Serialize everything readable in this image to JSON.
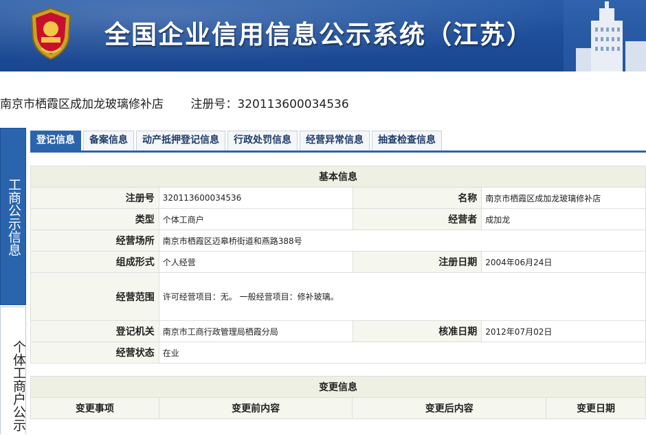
{
  "banner": {
    "title": "全国企业信用信息公示系统（江苏）",
    "emblem_icon": "national-emblem-icon",
    "colors": {
      "background": "#1f4f9a",
      "title": "#ffffff"
    }
  },
  "company": {
    "name": "南京市栖霞区成加龙玻璃修补店",
    "reg_label": "注册号：320113600034536"
  },
  "side_tabs": [
    {
      "label": "工商公示信息",
      "active": true
    },
    {
      "label": "个体工商户公示",
      "active": false
    }
  ],
  "tabs": [
    {
      "label": "登记信息",
      "active": true
    },
    {
      "label": "备案信息",
      "active": false
    },
    {
      "label": "动产抵押登记信息",
      "active": false
    },
    {
      "label": "行政处罚信息",
      "active": false
    },
    {
      "label": "经营异常信息",
      "active": false
    },
    {
      "label": "抽查检查信息",
      "active": false
    }
  ],
  "basic_info": {
    "title": "基本信息",
    "reg_no_label": "注册号",
    "reg_no": "320113600034536",
    "name_label": "名称",
    "name": "南京市栖霞区成加龙玻璃修补店",
    "type_label": "类型",
    "type": "个体工商户",
    "operator_label": "经营者",
    "operator": "成加龙",
    "place_label": "经营场所",
    "place": "南京市栖霞区迈皋桥街道和燕路388号",
    "form_label": "组成形式",
    "form": "个人经营",
    "reg_date_label": "注册日期",
    "reg_date": "2004年06月24日",
    "scope_label": "经营范围",
    "scope": "许可经营项目：无。 一般经营项目：修补玻璃。",
    "authority_label": "登记机关",
    "authority": "南京市工商行政管理局栖霞分局",
    "approve_date_label": "核准日期",
    "approve_date": "2012年07月02日",
    "status_label": "经营状态",
    "status": "在业"
  },
  "change_info": {
    "title": "变更信息",
    "columns": [
      "变更事项",
      "变更前内容",
      "变更后内容",
      "变更日期"
    ]
  },
  "accent_color": "#2a64ad"
}
